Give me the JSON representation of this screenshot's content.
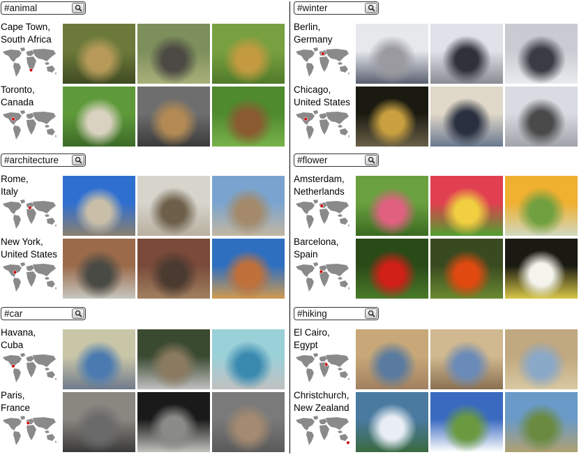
{
  "left_column": {
    "sections": [
      {
        "tag": "#animal",
        "rows": [
          {
            "city": "Cape Town,",
            "country": "South Africa",
            "photos": [
              "lions resting on grass",
              "elephant in bush",
              "lion lying on grass"
            ]
          },
          {
            "city": "Toronto,",
            "country": "Canada",
            "photos": [
              "fluffy white dog on grass",
              "chipmunk on pavement",
              "squirrel on grass"
            ]
          }
        ]
      },
      {
        "tag": "#architecture",
        "rows": [
          {
            "city": "Rome,",
            "country": "Italy",
            "photos": [
              "St. Peter's dome",
              "medieval stone tower",
              "domed church"
            ]
          },
          {
            "city": "New York,",
            "country": "United States",
            "photos": [
              "brick building with Broadway sign",
              "brick apartment with fire escapes",
              "tall brick building"
            ]
          }
        ]
      },
      {
        "tag": "#car",
        "rows": [
          {
            "city": "Havana,",
            "country": "Cuba",
            "photos": [
              "blue vintage car",
              "maroon vintage car",
              "light blue vintage car"
            ]
          },
          {
            "city": "Paris,",
            "country": "France",
            "photos": [
              "traffic on avenue",
              "silver sports car",
              "narrow street with cars"
            ]
          }
        ]
      }
    ]
  },
  "right_column": {
    "sections": [
      {
        "tag": "#winter",
        "rows": [
          {
            "city": "Berlin,",
            "country": "Germany",
            "photos": [
              "Reichstag in snow",
              "people walking in snow",
              "snow-covered memorial blocks"
            ]
          },
          {
            "city": "Chicago,",
            "country": "United States",
            "photos": [
              "Cloud Gate at night",
              "frozen lake at sunset",
              "bare trees in snowy park"
            ]
          }
        ]
      },
      {
        "tag": "#flower",
        "rows": [
          {
            "city": "Amsterdam,",
            "country": "Netherlands",
            "photos": [
              "tulip field",
              "colorful tulips",
              "yellow tulip garden"
            ]
          },
          {
            "city": "Barcelona,",
            "country": "Spain",
            "photos": [
              "red rose",
              "red poppy",
              "white daisies"
            ]
          }
        ]
      },
      {
        "tag": "#hiking",
        "rows": [
          {
            "city": "El Cairo,",
            "country": "Egypt",
            "photos": [
              "hiker on desert cliff",
              "rocky desert ruins",
              "desert trail"
            ]
          },
          {
            "city": "Christchurch,",
            "country": "New Zealand",
            "photos": [
              "snowy mountain view",
              "green hills under clouds",
              "grassy highland"
            ]
          }
        ]
      }
    ]
  },
  "icons": {
    "search": "search-icon",
    "map": "world-map-icon"
  },
  "colors": {
    "map_land": "#8a8a8a",
    "map_marker": "#cc0000",
    "divider": "#000000"
  }
}
